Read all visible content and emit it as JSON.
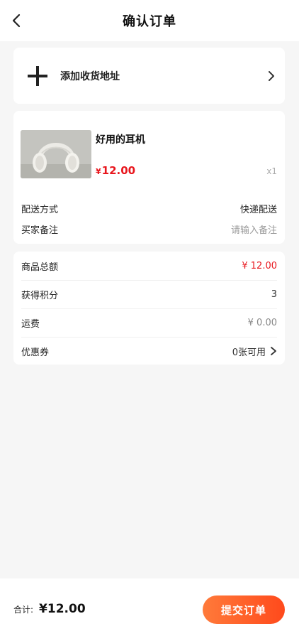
{
  "header": {
    "title": "确认订单",
    "back_icon": "chevron-left-icon"
  },
  "address": {
    "label": "添加收货地址",
    "plus_icon": "plus-icon",
    "arrow_icon": "chevron-right-icon"
  },
  "goods": {
    "name": "好用的耳机",
    "price_symbol": "¥",
    "price": "12.00",
    "quantity": "x1",
    "image_icon": "headphones-image"
  },
  "order": {
    "delivery_label": "配送方式",
    "delivery_value": "快递配送",
    "note_label": "买家备注",
    "note_placeholder": "请输入备注"
  },
  "summary": {
    "rows": [
      {
        "label": "商品总额",
        "value": "¥ 12.00"
      },
      {
        "label": "获得积分",
        "value": "3"
      },
      {
        "label": "运费",
        "value": "¥ 0.00"
      },
      {
        "label": "优惠券",
        "value": "0张可用"
      }
    ]
  },
  "footer": {
    "total_label": "合计:",
    "total_amount": "¥12.00",
    "submit_label": "提交订单"
  },
  "colors": {
    "accent_red": "#e8161d",
    "button_start": "#ff7a3a",
    "button_end": "#ff4a1c",
    "background": "#f6f6f6"
  }
}
